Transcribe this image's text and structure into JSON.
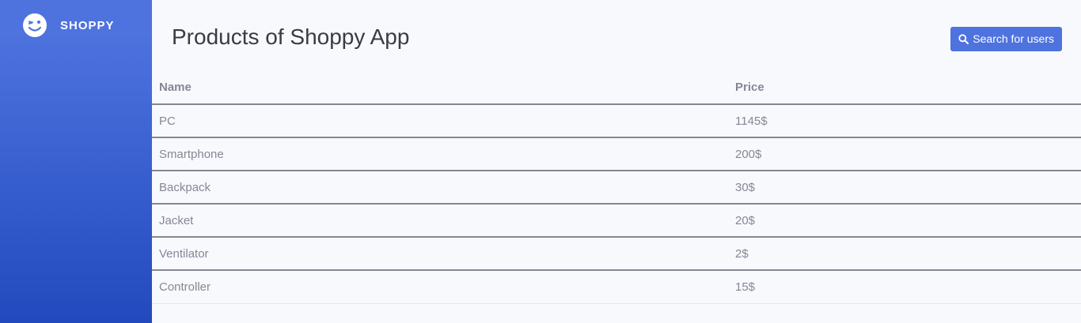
{
  "sidebar": {
    "brand": {
      "name": "SHOPPY",
      "icon": "wink-face-icon"
    }
  },
  "header": {
    "title": "Products of Shoppy App",
    "search_button_label": "Search for users",
    "search_icon": "search-icon"
  },
  "table": {
    "columns": [
      "Name",
      "Price"
    ],
    "rows": [
      {
        "name": "PC",
        "price": "1145$"
      },
      {
        "name": "Smartphone",
        "price": "200$"
      },
      {
        "name": "Backpack",
        "price": "30$"
      },
      {
        "name": "Jacket",
        "price": "20$"
      },
      {
        "name": "Ventilator",
        "price": "2$"
      },
      {
        "name": "Controller",
        "price": "15$"
      }
    ]
  },
  "colors": {
    "sidebar_top": "#4e73df",
    "sidebar_bottom": "#224abe",
    "accent": "#4e73df",
    "text_muted": "#858796",
    "title_text": "#3a3b45",
    "background": "#f8f9fc"
  }
}
